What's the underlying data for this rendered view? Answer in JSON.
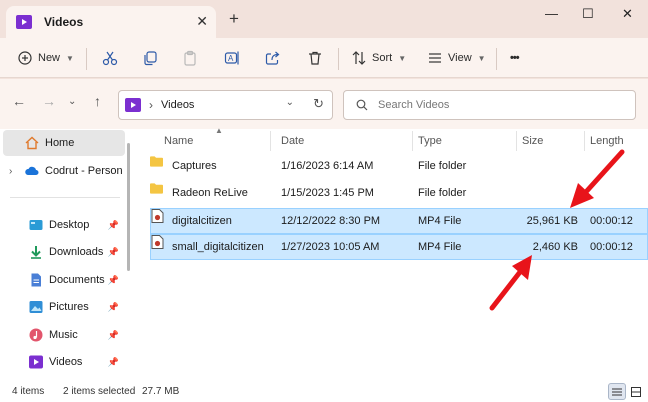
{
  "window": {
    "tab_title": "Videos",
    "new_tab_glyph": "+",
    "close_tab_glyph": "✕",
    "minimize_glyph": "—",
    "maximize_glyph": "☐",
    "close_glyph": "✕"
  },
  "toolbar": {
    "new_label": "New",
    "sort_label": "Sort",
    "view_label": "View",
    "more_glyph": "•••",
    "icons": [
      "cut-icon",
      "copy-icon",
      "paste-icon",
      "rename-icon",
      "share-icon",
      "delete-icon"
    ]
  },
  "address": {
    "current": "Videos",
    "search_placeholder": "Search Videos"
  },
  "sidebar": {
    "items": [
      {
        "label": "Home",
        "icon": "home-icon",
        "active": true
      },
      {
        "label": "Codrut - Person",
        "icon": "onedrive-icon"
      },
      {
        "label": "Desktop",
        "icon": "desktop-icon",
        "pinned": true
      },
      {
        "label": "Downloads",
        "icon": "downloads-icon",
        "pinned": true
      },
      {
        "label": "Documents",
        "icon": "documents-icon",
        "pinned": true
      },
      {
        "label": "Pictures",
        "icon": "pictures-icon",
        "pinned": true
      },
      {
        "label": "Music",
        "icon": "music-icon",
        "pinned": true
      },
      {
        "label": "Videos",
        "icon": "videos-icon",
        "pinned": true
      }
    ]
  },
  "columns": {
    "name": "Name",
    "date": "Date",
    "type": "Type",
    "size": "Size",
    "length": "Length"
  },
  "files": [
    {
      "name": "Captures",
      "date": "1/16/2023 6:14 AM",
      "type": "File folder",
      "size": "",
      "length": "",
      "kind": "folder",
      "selected": false
    },
    {
      "name": "Radeon ReLive",
      "date": "1/15/2023 1:45 PM",
      "type": "File folder",
      "size": "",
      "length": "",
      "kind": "folder",
      "selected": false
    },
    {
      "name": "digitalcitizen",
      "date": "12/12/2022 8:30 PM",
      "type": "MP4 File",
      "size": "25,961 KB",
      "length": "00:00:12",
      "kind": "video",
      "selected": true
    },
    {
      "name": "small_digitalcitizen",
      "date": "1/27/2023 10:05 AM",
      "type": "MP4 File",
      "size": "2,460 KB",
      "length": "00:00:12",
      "kind": "video",
      "selected": true
    }
  ],
  "status": {
    "count": "4 items",
    "selection": "2 items selected",
    "selection_size": "27.7 MB"
  },
  "colors": {
    "accent": "#7b2fd0",
    "folder": "#f4c542",
    "selection_bg": "#cce8ff",
    "arrow": "#e8141a"
  }
}
